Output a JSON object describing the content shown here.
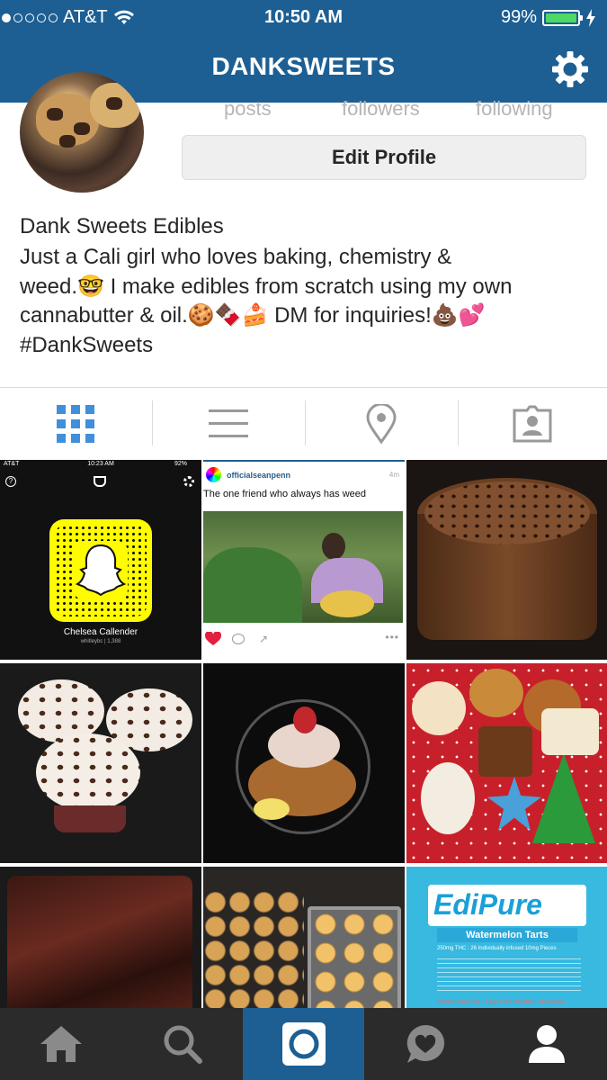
{
  "status_bar": {
    "carrier": "AT&T",
    "time": "10:50 AM",
    "battery_percent": "99%",
    "signal_bars_filled": 1
  },
  "nav": {
    "title": "DANKSWEETS"
  },
  "profile": {
    "stats": [
      {
        "label": "posts"
      },
      {
        "label": "followers"
      },
      {
        "label": "following"
      }
    ],
    "edit_button_label": "Edit Profile",
    "name": "Dank Sweets Edibles",
    "bio_line1": "Just a Cali girl who loves baking, chemistry &",
    "bio_line2": "weed.🤓 I make edibles from scratch using my own",
    "bio_line3": "cannabutter & oil.🍪🍫🍰 DM for inquiries!💩💕",
    "bio_line4": "#DankSweets"
  },
  "tabs": [
    {
      "name": "grid",
      "active": true
    },
    {
      "name": "list"
    },
    {
      "name": "location"
    },
    {
      "name": "tagged"
    }
  ],
  "posts": {
    "snapchat": {
      "status_carrier": "AT&T",
      "status_time": "10:23 AM",
      "status_battery": "92%",
      "name": "Chelsea Callender",
      "sub": "whitleybc | 1,388"
    },
    "repost": {
      "username": "officialseanpenn",
      "age": "4m",
      "caption": "The one friend who always has weed"
    },
    "edipure": {
      "brand": "EdiPure",
      "product": "Watermelon Tarts",
      "dose": "250mg THC : 26 Individually infused 10mg Pieces",
      "warning": "Medical Use Only – Keep From Children – No Resale"
    }
  },
  "colors": {
    "brand_blue": "#1d5f93",
    "tab_active": "#3f8fdb",
    "tab_inactive": "#999999"
  }
}
